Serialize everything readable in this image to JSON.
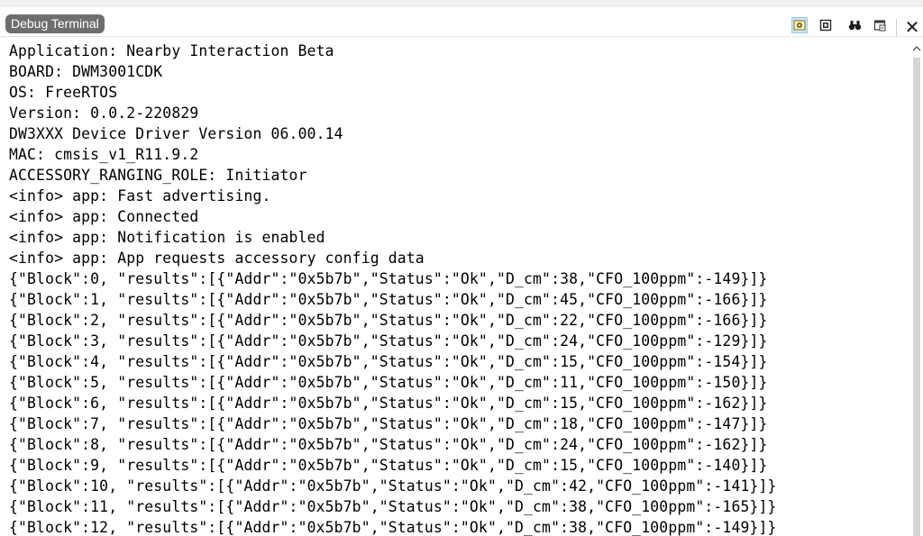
{
  "window": {
    "title": "Debug Terminal",
    "toolbar": [
      {
        "name": "settings-icon",
        "active": true
      },
      {
        "name": "clear-icon",
        "active": false
      },
      {
        "name": "binoculars-find-icon",
        "active": false
      },
      {
        "name": "save-log-icon",
        "active": false
      }
    ],
    "close_label": "✕"
  },
  "terminal": {
    "lines": [
      "Application: Nearby Interaction Beta",
      "BOARD: DWM3001CDK",
      "OS: FreeRTOS",
      "Version: 0.0.2-220829",
      "DW3XXX Device Driver Version 06.00.14",
      "MAC: cmsis_v1_R11.9.2",
      "ACCESSORY_RANGING_ROLE: Initiator",
      "<info> app: Fast advertising.",
      "<info> app: Connected",
      "<info> app: Notification is enabled",
      "<info> app: App requests accessory config data",
      "{\"Block\":0, \"results\":[{\"Addr\":\"0x5b7b\",\"Status\":\"Ok\",\"D_cm\":38,\"CFO_100ppm\":-149}]}",
      "{\"Block\":1, \"results\":[{\"Addr\":\"0x5b7b\",\"Status\":\"Ok\",\"D_cm\":45,\"CFO_100ppm\":-166}]}",
      "{\"Block\":2, \"results\":[{\"Addr\":\"0x5b7b\",\"Status\":\"Ok\",\"D_cm\":22,\"CFO_100ppm\":-166}]}",
      "{\"Block\":3, \"results\":[{\"Addr\":\"0x5b7b\",\"Status\":\"Ok\",\"D_cm\":24,\"CFO_100ppm\":-129}]}",
      "{\"Block\":4, \"results\":[{\"Addr\":\"0x5b7b\",\"Status\":\"Ok\",\"D_cm\":15,\"CFO_100ppm\":-154}]}",
      "{\"Block\":5, \"results\":[{\"Addr\":\"0x5b7b\",\"Status\":\"Ok\",\"D_cm\":11,\"CFO_100ppm\":-150}]}",
      "{\"Block\":6, \"results\":[{\"Addr\":\"0x5b7b\",\"Status\":\"Ok\",\"D_cm\":15,\"CFO_100ppm\":-162}]}",
      "{\"Block\":7, \"results\":[{\"Addr\":\"0x5b7b\",\"Status\":\"Ok\",\"D_cm\":18,\"CFO_100ppm\":-147}]}",
      "{\"Block\":8, \"results\":[{\"Addr\":\"0x5b7b\",\"Status\":\"Ok\",\"D_cm\":24,\"CFO_100ppm\":-162}]}",
      "{\"Block\":9, \"results\":[{\"Addr\":\"0x5b7b\",\"Status\":\"Ok\",\"D_cm\":15,\"CFO_100ppm\":-140}]}",
      "{\"Block\":10, \"results\":[{\"Addr\":\"0x5b7b\",\"Status\":\"Ok\",\"D_cm\":42,\"CFO_100ppm\":-141}]}",
      "{\"Block\":11, \"results\":[{\"Addr\":\"0x5b7b\",\"Status\":\"Ok\",\"D_cm\":38,\"CFO_100ppm\":-165}]}",
      "{\"Block\":12, \"results\":[{\"Addr\":\"0x5b7b\",\"Status\":\"Ok\",\"D_cm\":38,\"CFO_100ppm\":-149}]}"
    ]
  },
  "colors": {
    "title_pill_bg": "#6e6e6e",
    "active_tool_bg": "#cce4f7",
    "terminal_text": "#000000",
    "scroll_thumb": "#d4d4d4"
  }
}
